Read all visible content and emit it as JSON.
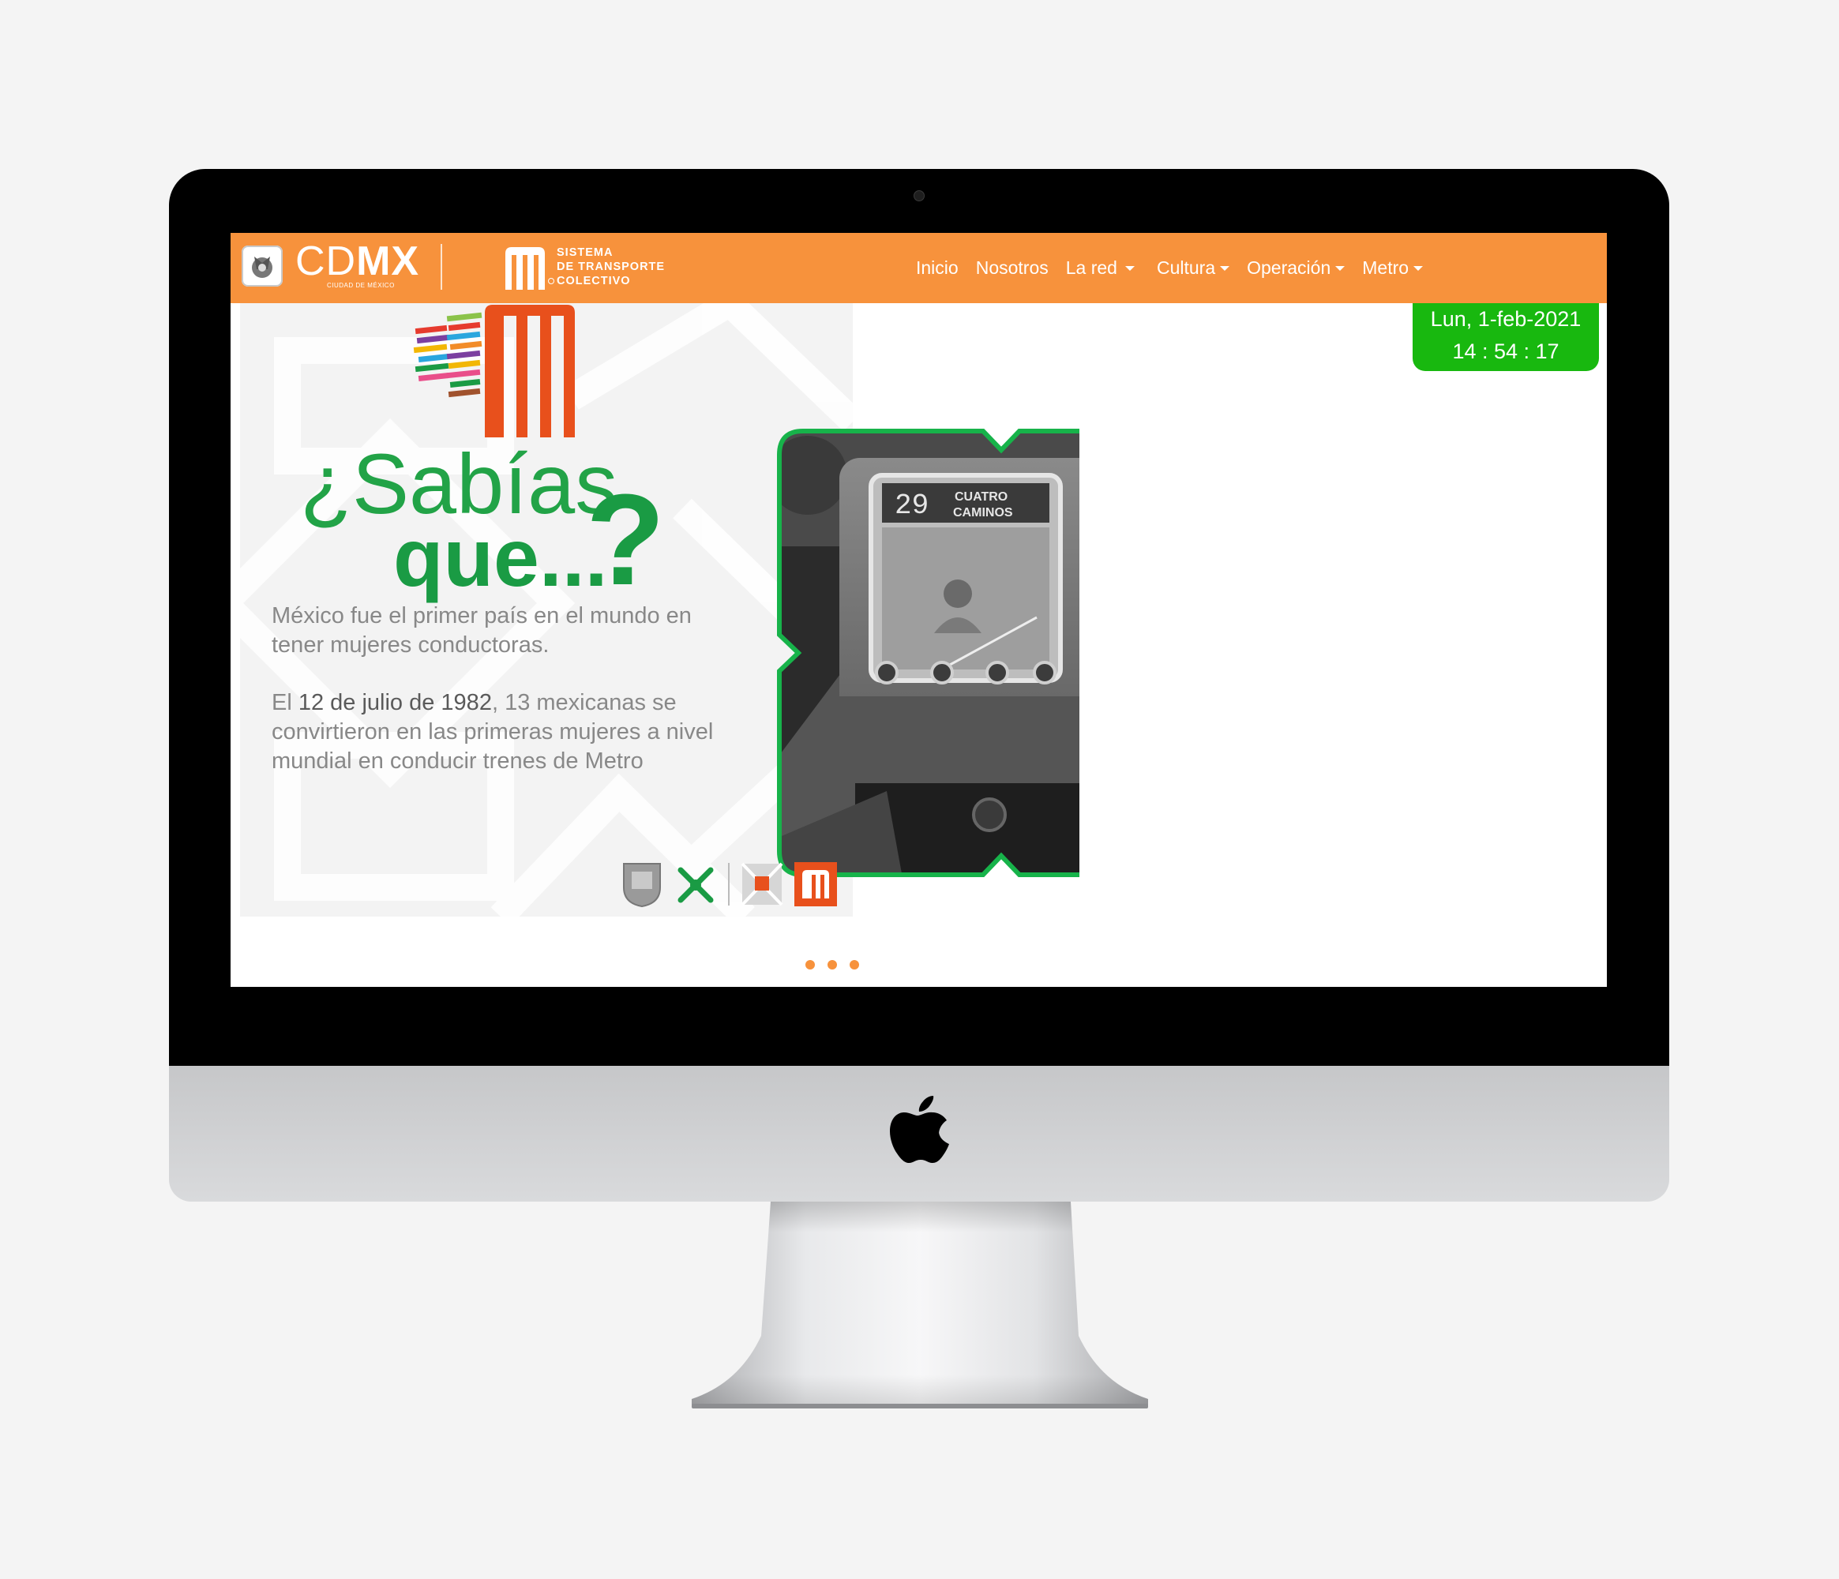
{
  "brand": {
    "cdmx_light": "CD",
    "cdmx_bold": "MX",
    "cdmx_sub": "CIUDAD DE MÉXICO",
    "stc_line1": "SISTEMA",
    "stc_line2": "DE TRANSPORTE",
    "stc_line3": "COLECTIVO"
  },
  "nav": {
    "items": [
      {
        "label": "Inicio",
        "dropdown": false
      },
      {
        "label": "Nosotros",
        "dropdown": false
      },
      {
        "label": "La red",
        "dropdown": true
      },
      {
        "label": "Cultura",
        "dropdown": true
      },
      {
        "label": "Operación",
        "dropdown": true
      },
      {
        "label": "Metro",
        "dropdown": true
      }
    ]
  },
  "clock": {
    "date": "Lun, 1-feb-2021",
    "time": "14 : 54 : 17"
  },
  "slide": {
    "heading_part1": "¿Sabías",
    "heading_part2": "que...",
    "heading_qmark": "?",
    "paragraph1": "México fue el primer país en el mundo en tener mujeres conductoras.",
    "paragraph2_prefix": "El ",
    "paragraph2_bold": "12 de julio de 1982",
    "paragraph2_suffix": ", 13 mexicanas se convirtieron en las primeras mujeres a nivel mundial en conducir trenes de Metro",
    "train_sign_number": "29",
    "train_sign_dest1": "CUATRO",
    "train_sign_dest2": "CAMINOS"
  },
  "carousel": {
    "slides": 3,
    "active": 1
  },
  "colors": {
    "accent_orange": "#f7923c",
    "clock_green": "#18b80f",
    "heading_green": "#1a9b44",
    "frame_green": "#17b34a",
    "metro_orange": "#e8501c"
  },
  "icons": [
    "cdmx-emblem-icon",
    "metro-logo-icon",
    "caret-down-icon",
    "apple-logo-icon",
    "escudo-icon",
    "cdmx-glyph-icon",
    "metro-pattern-icon"
  ]
}
